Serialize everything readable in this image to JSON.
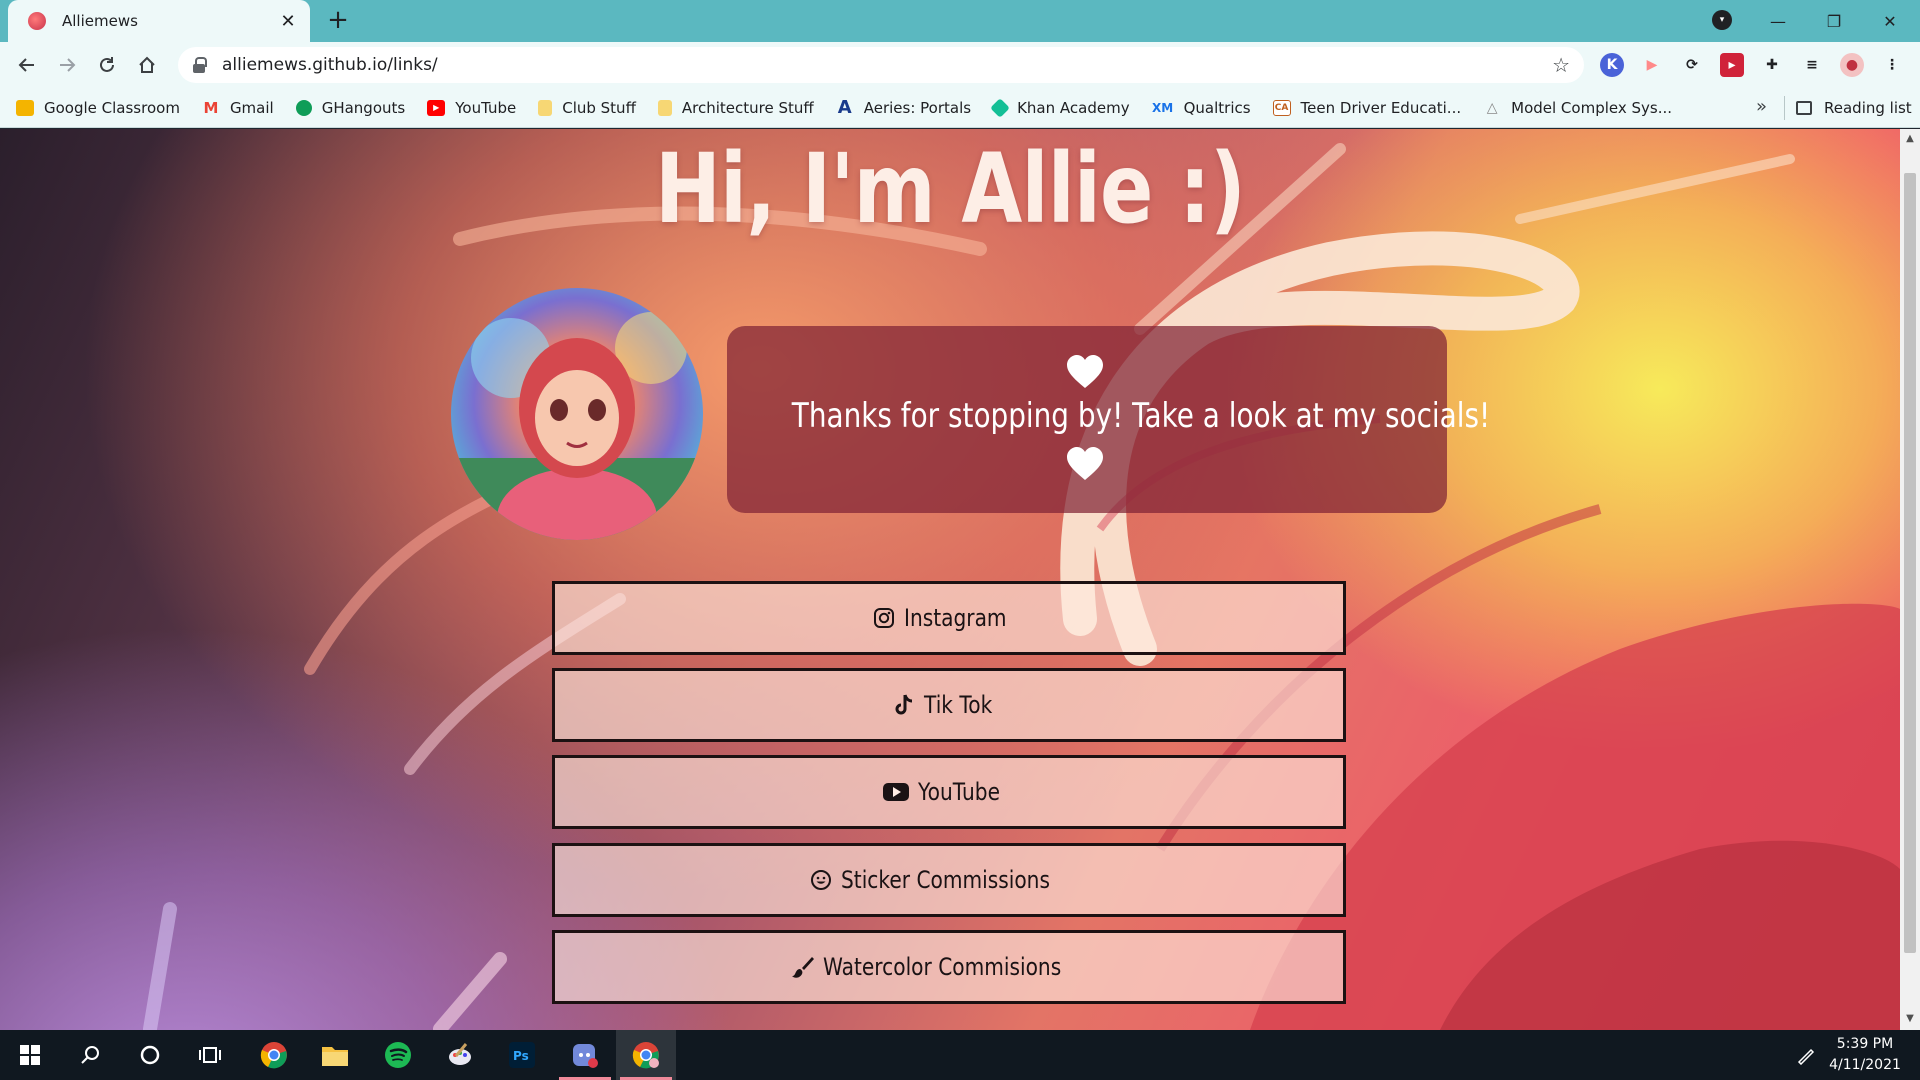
{
  "browser": {
    "tab_title": "Alliemews",
    "tab_close": "✕",
    "new_tab": "+",
    "url": "alliemews.github.io/links/",
    "window_controls": {
      "minimize": "—",
      "restore": "❐",
      "close": "✕"
    },
    "bookmarks": [
      {
        "label": "Google Classroom",
        "icon": "google-classroom-icon",
        "color": "#f4b400"
      },
      {
        "label": "Gmail",
        "icon": "gmail-icon",
        "color": "#ea4335"
      },
      {
        "label": "GHangouts",
        "icon": "hangouts-icon",
        "color": "#0f9d58"
      },
      {
        "label": "YouTube",
        "icon": "youtube-icon",
        "color": "#ff0000"
      },
      {
        "label": "Club Stuff",
        "icon": "folder-icon",
        "color": "#f7d774"
      },
      {
        "label": "Architecture Stuff",
        "icon": "folder-icon",
        "color": "#f7d774"
      },
      {
        "label": "Aeries: Portals",
        "icon": "aeries-icon",
        "color": "#1a3b8c"
      },
      {
        "label": "Khan Academy",
        "icon": "khan-academy-icon",
        "color": "#14bf96"
      },
      {
        "label": "Qualtrics",
        "icon": "qualtrics-icon",
        "color": "#1a73e8"
      },
      {
        "label": "Teen Driver Educati...",
        "icon": "ca-icon",
        "color": "#c06020"
      },
      {
        "label": "Model Complex Sys...",
        "icon": "drive-icon",
        "color": "#8a8a8a"
      }
    ],
    "bookmarks_more": "»",
    "reading_list": "Reading list"
  },
  "page": {
    "title": "Hi, I'm Allie :)",
    "welcome": "Thanks for stopping by! Take a look at my socials!",
    "links": [
      {
        "label": "Instagram",
        "icon": "instagram-icon"
      },
      {
        "label": "Tik Tok",
        "icon": "tiktok-icon"
      },
      {
        "label": "YouTube",
        "icon": "youtube-icon"
      },
      {
        "label": "Sticker Commissions",
        "icon": "smile-icon"
      },
      {
        "label": "Watercolor Commisions",
        "icon": "paintbrush-icon"
      }
    ]
  },
  "taskbar": {
    "time": "5:39 PM",
    "date": "4/11/2021",
    "apps": [
      "windows-start-icon",
      "search-icon",
      "cortana-icon",
      "task-view-icon",
      "chrome-icon",
      "file-explorer-icon",
      "spotify-icon",
      "paint-icon",
      "photoshop-icon",
      "discord-icon",
      "chrome-profile-icon"
    ]
  },
  "colors": {
    "tab_bar": "#5bb8c0",
    "toolbar": "#eef9f9",
    "welcome_box": "#80223a",
    "button_border": "#1c1112",
    "taskbar": "#101820"
  }
}
